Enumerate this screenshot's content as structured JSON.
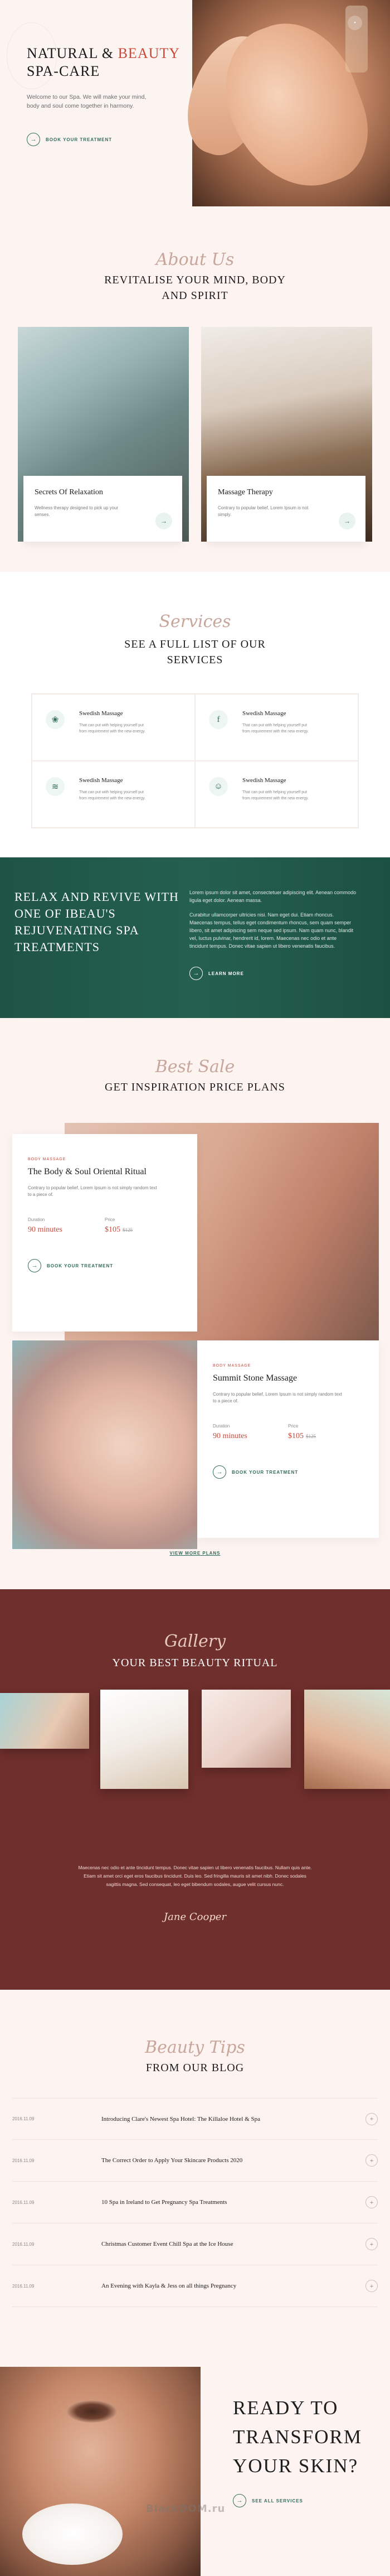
{
  "hero": {
    "title_line1": "NATURAL & ",
    "title_accent": "BEAUTY",
    "title_line2": "SPA-CARE",
    "subtitle": "Welcome to our Spa. We will make your mind, body and soul come together in harmony.",
    "cta_label": "BOOK YOUR TREATMENT",
    "badge": "•"
  },
  "about": {
    "script": "About Us",
    "title_line1": "REVITALISE YOUR MIND, BODY",
    "title_line2": "AND SPIRIT",
    "cards": [
      {
        "title": "Secrets Of Relaxation",
        "text": "Wellness therapy designed to pick up your senses."
      },
      {
        "title": "Massage Therapy",
        "text": "Contrary to popular belief, Lorem Ipsum is not simply."
      }
    ]
  },
  "services": {
    "script": "Services",
    "title_line1": "SEE A FULL LIST OF OUR",
    "title_line2": "SERVICES",
    "items": [
      {
        "title": "Swedish Massage",
        "text": "That can put with helping yourself put from requirement with the new energy.",
        "icon": "leaf-face-icon",
        "glyph": "❀"
      },
      {
        "title": "Swedish Massage",
        "text": "That can put with helping yourself put from requirement with the new energy.",
        "icon": "facebook-f-icon",
        "glyph": "f"
      },
      {
        "title": "Swedish Massage",
        "text": "That can put with helping yourself put from requirement with the new energy.",
        "icon": "stones-icon",
        "glyph": "≋"
      },
      {
        "title": "Swedish Massage",
        "text": "That can put with helping yourself put from requirement with the new energy.",
        "icon": "body-icon",
        "glyph": "☺"
      }
    ]
  },
  "banner": {
    "heading": "RELAX AND REVIVE WITH ONE OF IBEAU'S REJUVENATING SPA TREATMENTS",
    "p1": "Lorem ipsum dolor sit amet, consectetuer adipiscing elit. Aenean commodo ligula eget dolor. Aenean massa.",
    "p2": "Curabitur ullamcorper ultricies nisi. Nam eget dui. Etiam rhoncus. Maecenas tempus, tellus eget condimentum rhoncus, sem quam semper libero, sit amet adipiscing sem neque sed ipsum. Nam quam nunc, blandit vel, luctus pulvinar, hendrerit id, lorem. Maecenas nec odio et ante tincidunt tempus. Donec vitae sapien ut libero venenatis faucibus.",
    "cta_label": "LEARN MORE"
  },
  "plans": {
    "script": "Best Sale",
    "title": "GET INSPIRATION PRICE PLANS",
    "items": [
      {
        "kicker": "BODY MASSAGE",
        "title": "The Body & Soul Oriental Ritual",
        "desc": "Contrary to popular belief, Lorem Ipsum is not simply random text to a piece of.",
        "duration_label": "Duration",
        "duration": "90 minutes",
        "price_label": "Price",
        "price": "$105",
        "old_price": "$125",
        "cta_label": "BOOK YOUR TREATMENT"
      },
      {
        "kicker": "BODY MASSAGE",
        "title": "Summit Stone Massage",
        "desc": "Contrary to popular belief, Lorem Ipsum is not simply random text to a piece of.",
        "duration_label": "Duration",
        "duration": "90 minutes",
        "price_label": "Price",
        "price": "$105",
        "old_price": "$125",
        "cta_label": "BOOK YOUR TREATMENT"
      }
    ],
    "view_more": "VIEW MORE PLANS"
  },
  "gallery": {
    "script": "Gallery",
    "title": "YOUR BEST BEAUTY RITUAL",
    "quote": "Maecenas nec odio et ante tincidunt tempus. Donec vitae sapien ut libero venenatis faucibus. Nullam quis ante. Etiam sit amet orci eget eros faucibus tincidunt. Duis leo. Sed fringilla mauris sit amet nibh. Donec sodales sagittis magna. Sed consequat, leo eget bibendum sodales, augue velit cursus nunc.",
    "signature": "Jane Cooper"
  },
  "blog": {
    "script": "Beauty Tips",
    "title": "FROM OUR BLOG",
    "items": [
      {
        "date": "2016.11.09",
        "title": "Introducing Clare's Newest Spa Hotel: The Killaloe Hotel & Spa"
      },
      {
        "date": "2016.11.09",
        "title": "The Correct Order to Apply Your Skincare Products 2020"
      },
      {
        "date": "2016.11.09",
        "title": "10 Spa in Ireland to Get Pregnancy Spa Treatments"
      },
      {
        "date": "2016.11.09",
        "title": "Christmas Customer Event Chill Spa at the Ice House"
      },
      {
        "date": "2016.11.09",
        "title": "An Evening with Kayla & Jess on all things Pregnancy"
      }
    ]
  },
  "ready": {
    "title": "READY TO TRANSFORM YOUR SKIN?",
    "cta_label": "SEE ALL SERVICES",
    "watermark": "BlackDOM.ru"
  },
  "colors": {
    "accent_red": "#c9493b",
    "green": "#25604f",
    "maroon": "#6f2f2c",
    "blush": "#fdf3f0"
  }
}
